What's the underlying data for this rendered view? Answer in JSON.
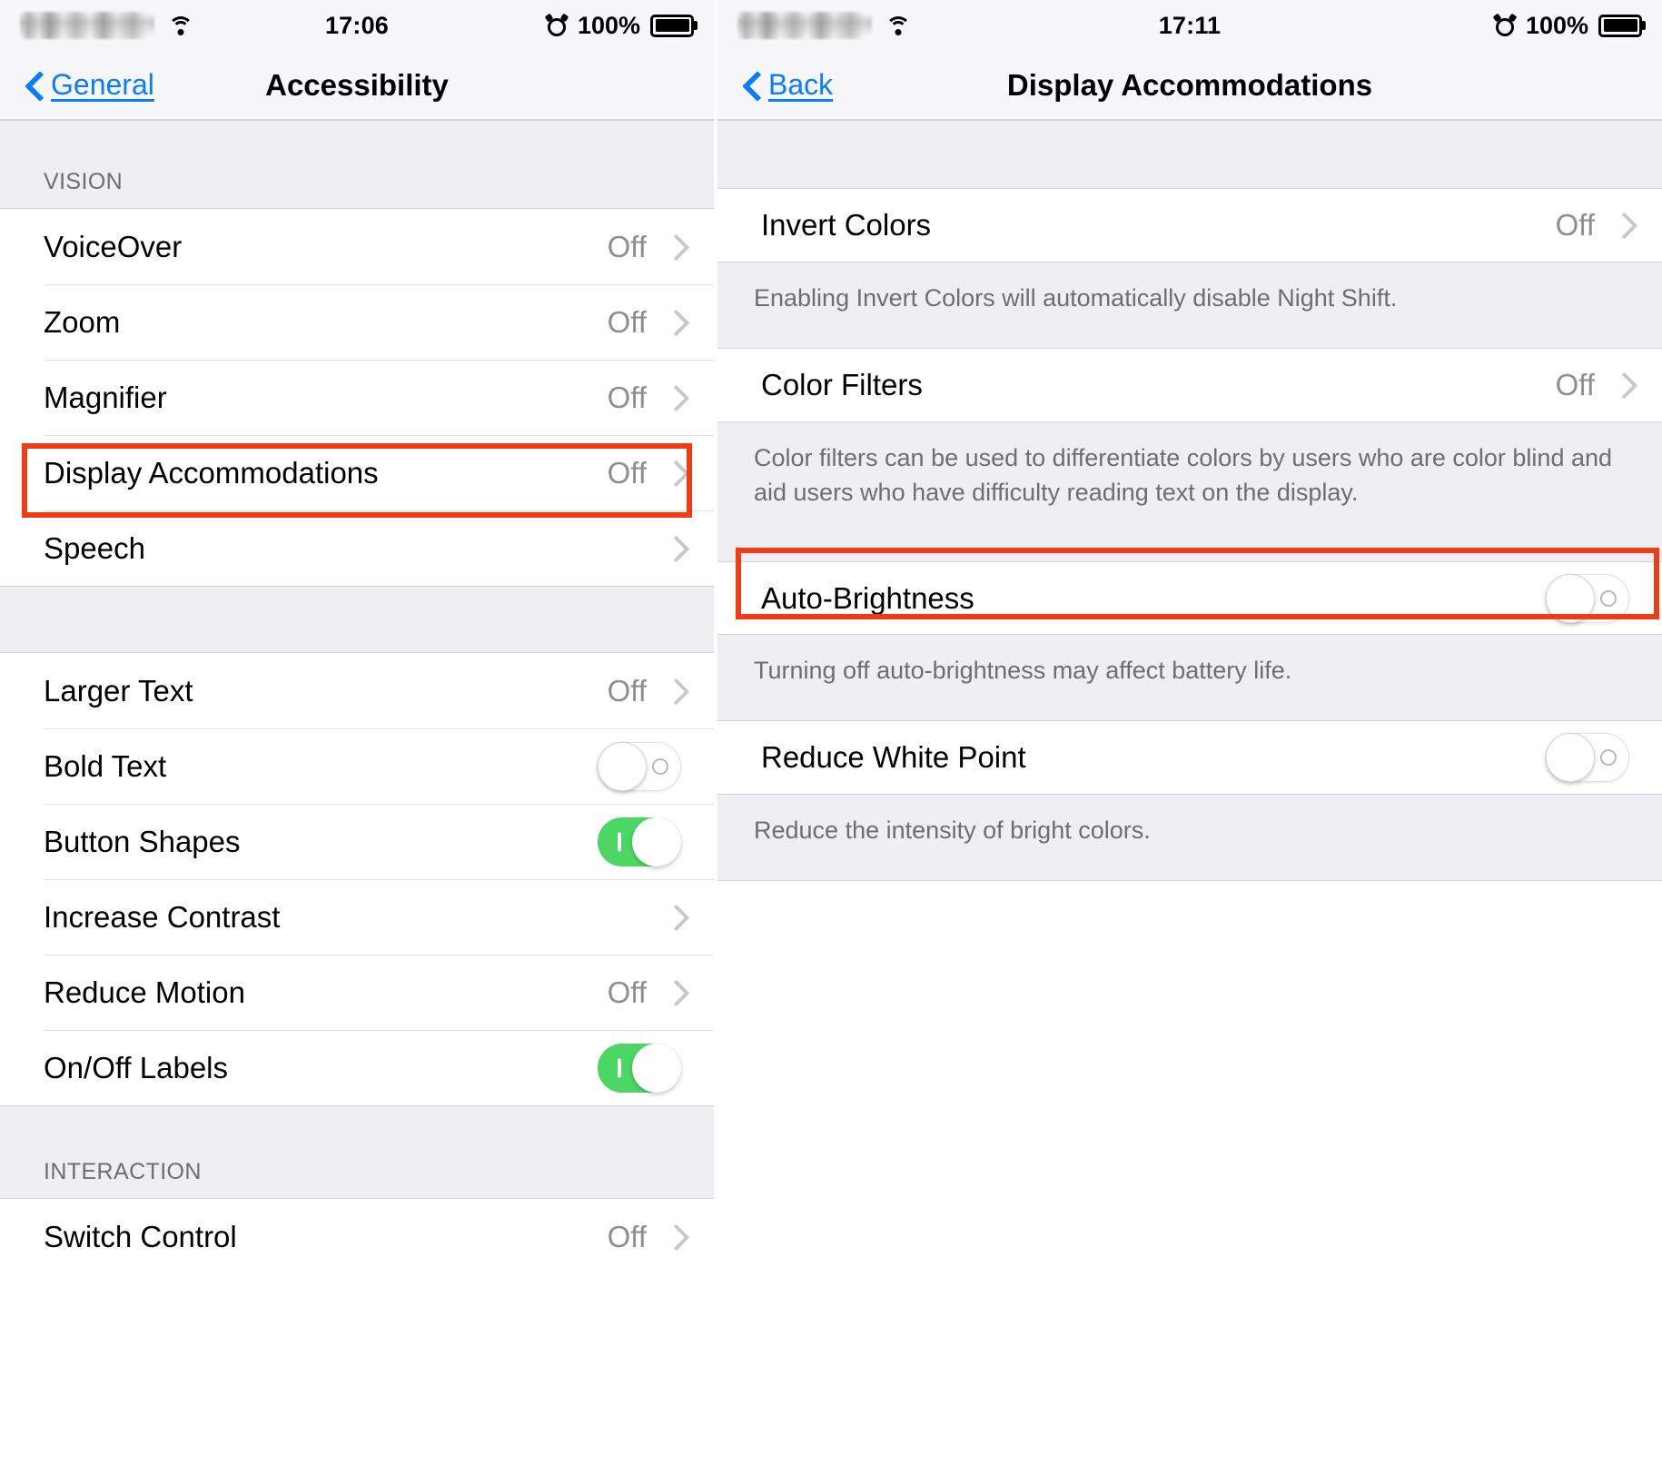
{
  "left_panel": {
    "status_bar": {
      "carrier": "",
      "wifi_icon": "wifi-icon",
      "time": "17:06",
      "alarm_icon": "alarm-clock-icon",
      "battery_percent": "100%",
      "battery_icon": "battery-full-icon"
    },
    "nav": {
      "back_label": "General",
      "back_icon": "chevron-left-icon",
      "title": "Accessibility"
    },
    "sections": [
      {
        "header": "VISION",
        "rows": [
          {
            "label": "VoiceOver",
            "value": "Off",
            "accessory": "chevron"
          },
          {
            "label": "Zoom",
            "value": "Off",
            "accessory": "chevron"
          },
          {
            "label": "Magnifier",
            "value": "Off",
            "accessory": "chevron"
          },
          {
            "label": "Display Accommodations",
            "value": "Off",
            "accessory": "chevron",
            "highlighted": true
          },
          {
            "label": "Speech",
            "value": "",
            "accessory": "chevron"
          }
        ]
      },
      {
        "header": "",
        "rows": [
          {
            "label": "Larger Text",
            "value": "Off",
            "accessory": "chevron"
          },
          {
            "label": "Bold Text",
            "value": "",
            "accessory": "toggle",
            "toggle_state": "off"
          },
          {
            "label": "Button Shapes",
            "value": "",
            "accessory": "toggle",
            "toggle_state": "on"
          },
          {
            "label": "Increase Contrast",
            "value": "",
            "accessory": "chevron"
          },
          {
            "label": "Reduce Motion",
            "value": "Off",
            "accessory": "chevron"
          },
          {
            "label": "On/Off Labels",
            "value": "",
            "accessory": "toggle",
            "toggle_state": "on"
          }
        ]
      },
      {
        "header": "INTERACTION",
        "rows": [
          {
            "label": "Switch Control",
            "value": "Off",
            "accessory": "chevron"
          }
        ]
      }
    ]
  },
  "right_panel": {
    "status_bar": {
      "carrier": "",
      "wifi_icon": "wifi-icon",
      "time": "17:11",
      "alarm_icon": "alarm-clock-icon",
      "battery_percent": "100%",
      "battery_icon": "battery-full-icon"
    },
    "nav": {
      "back_label": "Back",
      "back_icon": "chevron-left-icon",
      "title": "Display Accommodations"
    },
    "rows": [
      {
        "label": "Invert Colors",
        "value": "Off",
        "accessory": "chevron"
      },
      {
        "label": "Color Filters",
        "value": "Off",
        "accessory": "chevron"
      },
      {
        "label": "Auto-Brightness",
        "value": "",
        "accessory": "toggle",
        "toggle_state": "off",
        "highlighted": true
      },
      {
        "label": "Reduce White Point",
        "value": "",
        "accessory": "toggle",
        "toggle_state": "off"
      }
    ],
    "footers": [
      "Enabling Invert Colors will automatically disable Night Shift.",
      "Color filters can be used to differentiate colors by users who are color blind and aid users who have difficulty reading text on the display.",
      "Turning off auto-brightness may affect battery life.",
      "Reduce the intensity of bright colors."
    ]
  },
  "colors": {
    "accent_blue": "#0a7cff",
    "toggle_on_green": "#4cd663",
    "highlight_red": "#f03c14",
    "group_background": "#eeeef3",
    "secondary_text": "#8e8e93",
    "footer_text": "#6d6d72"
  }
}
